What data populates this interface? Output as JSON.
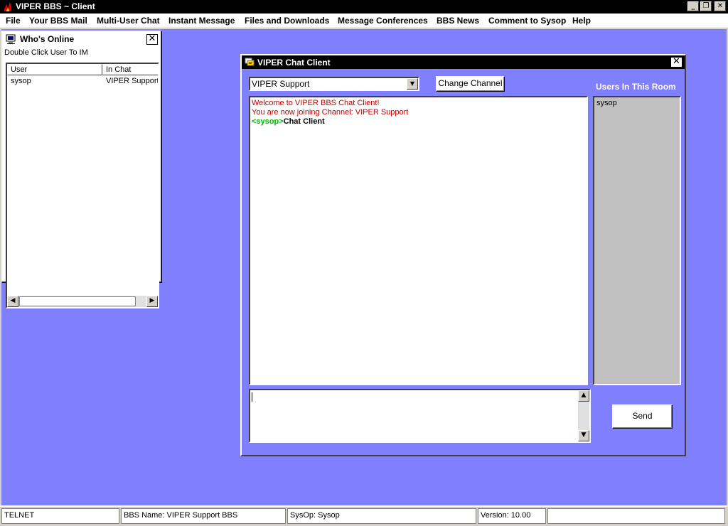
{
  "window": {
    "title": "VIPER BBS ~ Client",
    "minimize_glyph": "_",
    "maximize_glyph": "❐",
    "close_glyph": "✕"
  },
  "menu": [
    {
      "label": "File"
    },
    {
      "label": "Your BBS Mail"
    },
    {
      "label": "Multi-User Chat"
    },
    {
      "label": "Instant Message"
    },
    {
      "label": "Files and Downloads"
    },
    {
      "label": "Message Conferences"
    },
    {
      "label": "BBS News"
    },
    {
      "label": "Comment to Sysop"
    },
    {
      "label": "Help"
    }
  ],
  "whos_online": {
    "title": "Who's Online",
    "hint": "Double Click User To IM",
    "close_glyph": "✕",
    "columns": [
      "User",
      "In Chat"
    ],
    "rows": [
      {
        "user": "sysop",
        "in_chat": "VIPER Support"
      }
    ]
  },
  "chat": {
    "title": "VIPER Chat Client",
    "close_glyph": "✕",
    "channel": "VIPER Support",
    "change_channel_label": "Change Channel",
    "users_label": "Users In This Room",
    "users": [
      "sysop"
    ],
    "messages": {
      "system": [
        "Welcome to VIPER BBS Chat Client!",
        "You are now joining Channel: VIPER Support"
      ],
      "nick": "<sysop>",
      "text": "Chat Client"
    },
    "input_value": "",
    "send_label": "Send"
  },
  "statusbar": [
    "TELNET",
    "BBS Name: VIPER Support BBS",
    "SysOp: Sysop",
    "Version: 10.00"
  ],
  "colors": {
    "desktop": "#8080ff",
    "titlebar": "#000000",
    "system_message": "#c00000",
    "nick": "#00c000"
  }
}
